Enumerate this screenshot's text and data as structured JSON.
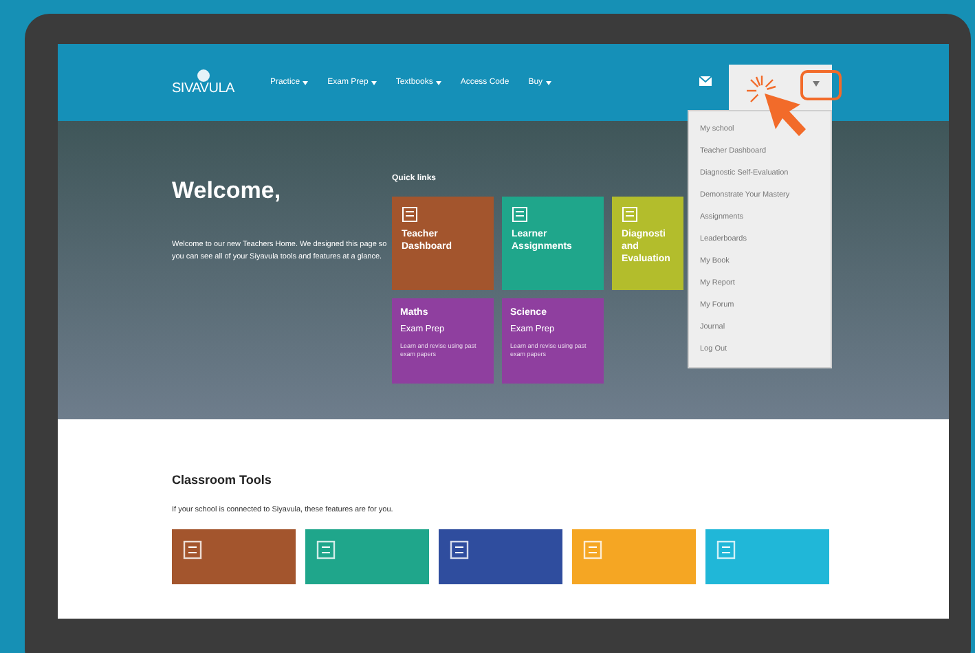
{
  "header": {
    "logo": "SIVAVULA",
    "nav": [
      {
        "label": "Practice",
        "has_menu": true
      },
      {
        "label": "Exam Prep",
        "has_menu": true
      },
      {
        "label": "Textbooks",
        "has_menu": true
      },
      {
        "label": "Access Code",
        "has_menu": false
      },
      {
        "label": "Buy",
        "has_menu": true
      }
    ],
    "account_menu": {
      "expanded": true,
      "items": [
        "My school",
        "Teacher Dashboard",
        "Diagnostic Self-Evaluation",
        "Demonstrate Your Mastery",
        "Assignments",
        "Leaderboards",
        "My Book",
        "My Report",
        "My Forum",
        "Journal",
        "Log Out"
      ]
    }
  },
  "hero": {
    "title": "Welcome,",
    "intro": "Welcome to our new Teachers Home. We designed this page so you can see all of your Siyavula tools and features at a glance.",
    "quick_links_label": "Quick links",
    "tiles": [
      {
        "kind": "link",
        "title": "Teacher Dashboard",
        "color": "#a3552d"
      },
      {
        "kind": "link",
        "title": "Learner Assignments",
        "color": "#1fa68b"
      },
      {
        "kind": "link",
        "title": "Diagnosti and Evaluation",
        "color": "#b3bd2c"
      },
      {
        "kind": "exam",
        "subject": "Maths",
        "subtitle": "Exam Prep",
        "description": "Learn and revise using past exam papers",
        "color": "#8f3f9f"
      },
      {
        "kind": "exam",
        "subject": "Science",
        "subtitle": "Exam Prep",
        "description": "Learn and revise using past exam papers",
        "color": "#8f3f9f"
      }
    ]
  },
  "classroom": {
    "title": "Classroom Tools",
    "subtitle": "If your school is connected to Siyavula, these features are for you.",
    "tiles": [
      {
        "color": "#a3552d"
      },
      {
        "color": "#1fa68b"
      },
      {
        "color": "#2f4d9e"
      },
      {
        "color": "#f5a623"
      },
      {
        "color": "#20b7d8"
      }
    ]
  }
}
